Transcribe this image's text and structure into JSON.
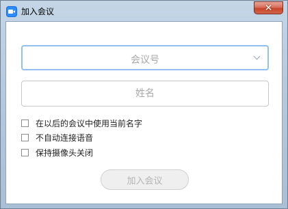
{
  "window": {
    "title": "加入会议",
    "close_symbol": "✕",
    "icon": "zoom-app-icon"
  },
  "form": {
    "meeting_id_placeholder": "会议号",
    "meeting_id_icon": "chevron-down-icon",
    "name_placeholder": "姓名",
    "options": [
      {
        "label": "在以后的会议中使用当前名字",
        "checked": false
      },
      {
        "label": "不自动连接语音",
        "checked": false
      },
      {
        "label": "保持摄像头关闭",
        "checked": false
      }
    ],
    "join_label": "加入会议",
    "join_enabled": false
  }
}
